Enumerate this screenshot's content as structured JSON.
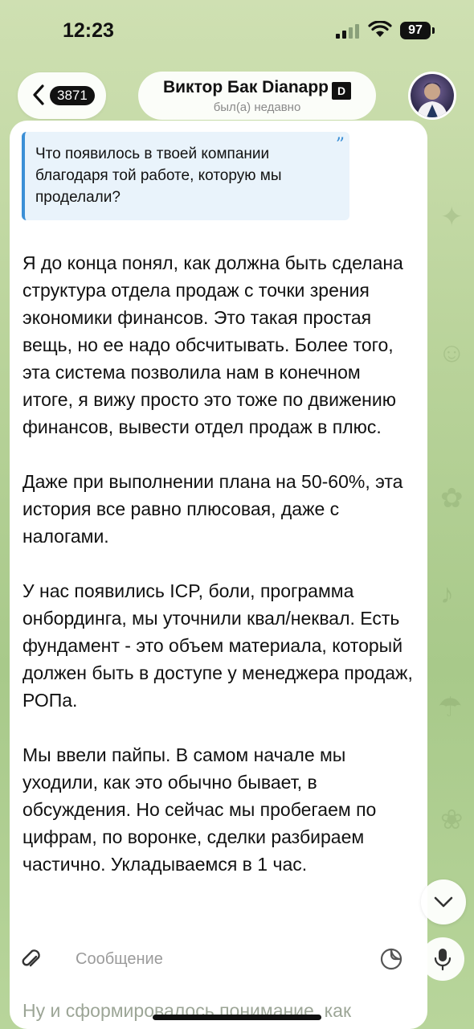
{
  "status_bar": {
    "time": "12:23",
    "battery": "97"
  },
  "header": {
    "back_count": "3871",
    "title": "Виктор Бак Dianapp",
    "title_logo": "D",
    "subtitle": "был(а) недавно"
  },
  "message": {
    "quote": "Что появилось в твоей компании благодаря той работе, которую мы проделали?",
    "paragraphs": [
      "Я до конца понял, как должна быть сделана структура отдела продаж с точки зрения экономики финансов. Это такая простая вещь, но ее надо обсчитывать. Более того, эта система позволила нам в конечном итоге, я вижу просто это тоже по движению финансов, вывести отдел продаж в плюс.",
      "Даже при  выполнении плана на 50-60%,  эта история все равно плюсовая, даже с налогами.",
      "У нас появились  ICP, боли, программа онбординга, мы уточнили квал/неквал. Есть фундамент - это объем материала, который должен быть в доступе у менеджера продаж, РОПа.",
      "Мы ввели пайпы. В самом начале мы уходили, как это обычно бывает, в обсуждения. Но сейчас мы пробегаем по цифрам, по воронке, сделки разбираем частично. Укладываемся в 1 час."
    ],
    "next_line": "Ну и сформировалось понимание, как"
  },
  "composer": {
    "placeholder": "Сообщение"
  },
  "icons": {
    "back": "chevron-left-icon",
    "scroll": "chevron-down-icon",
    "attach": "paperclip-icon",
    "sticker": "sticker-icon",
    "mic": "microphone-icon"
  },
  "colors": {
    "quote_accent": "#3b8fd6",
    "bubble": "#ffffff",
    "background": "#b9d39a"
  }
}
